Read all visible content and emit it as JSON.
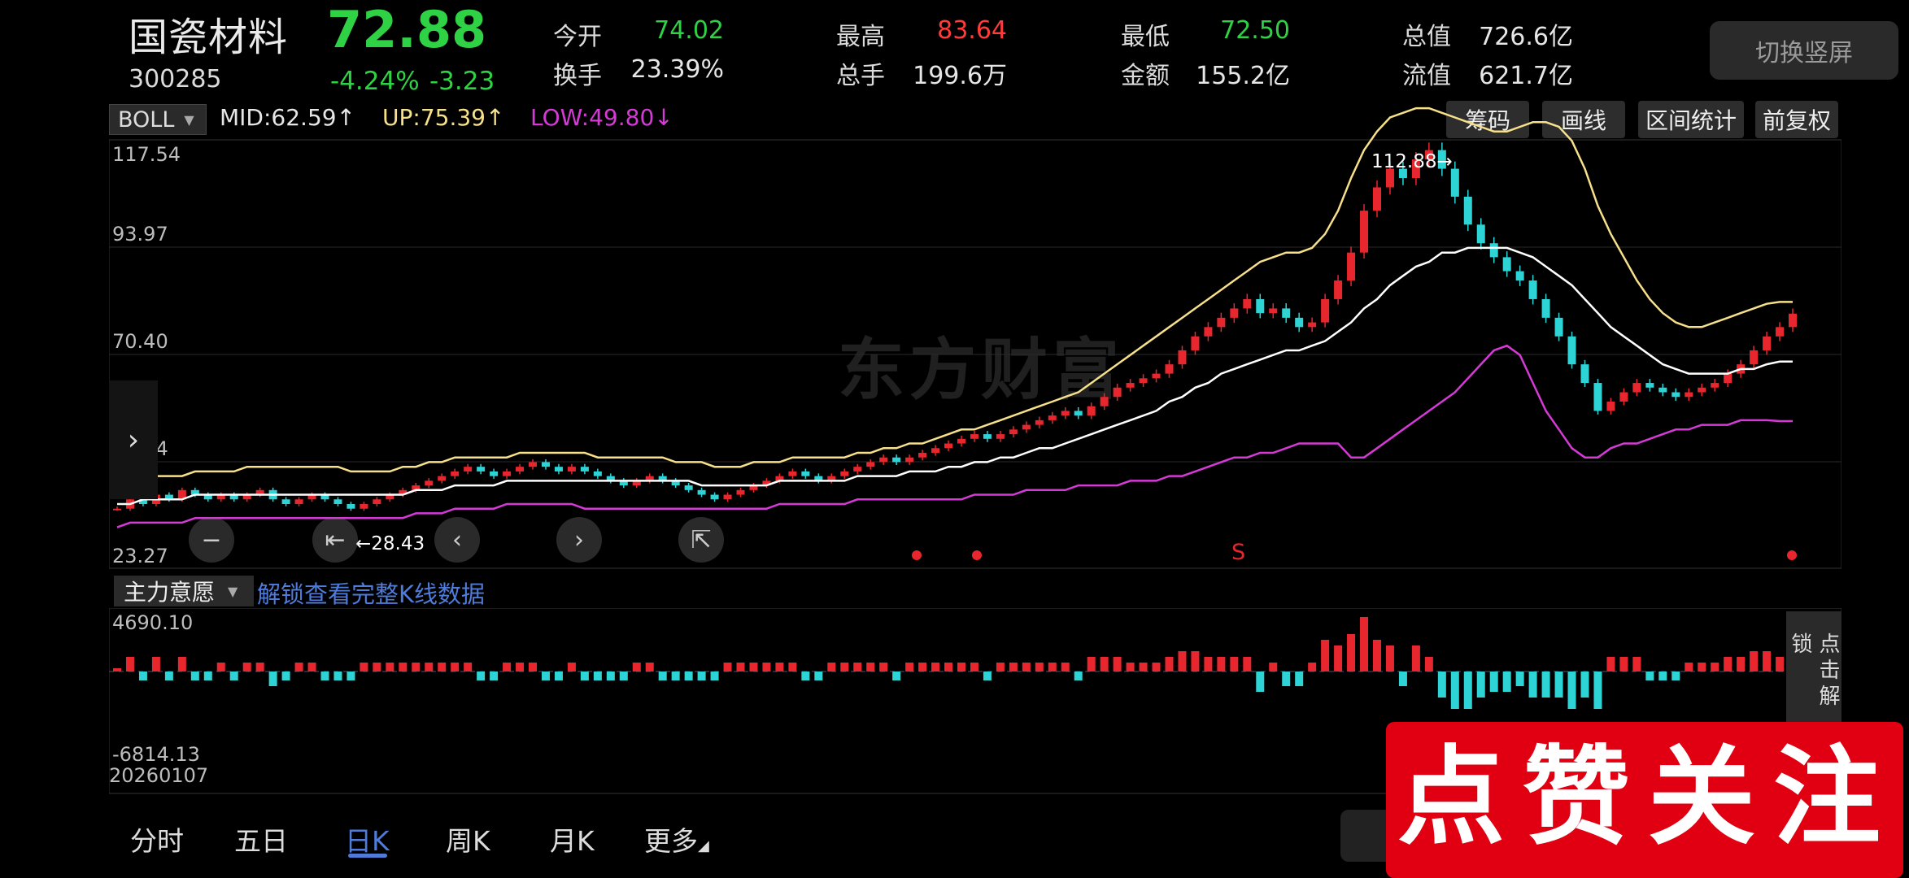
{
  "header": {
    "stock_name": "国瓷材料",
    "stock_code": "300285",
    "price": "72.88",
    "change_pct": "-4.24%",
    "change_amt": "-3.23",
    "stats": [
      {
        "label": "今开",
        "value": "74.02",
        "color": "green"
      },
      {
        "label": "换手",
        "value": "23.39%",
        "color": "white"
      },
      {
        "label": "最高",
        "value": "83.64",
        "color": "red"
      },
      {
        "label": "总手",
        "value": "199.6万",
        "color": "white"
      },
      {
        "label": "最低",
        "value": "72.50",
        "color": "green"
      },
      {
        "label": "金额",
        "value": "155.2亿",
        "color": "white"
      },
      {
        "label": "总值",
        "value": "726.6亿",
        "color": "white"
      },
      {
        "label": "流值",
        "value": "621.7亿",
        "color": "white"
      }
    ],
    "switch_label": "切换竖屏"
  },
  "indicator": {
    "name": "BOLL",
    "mid": "MID:62.59",
    "up": "UP:75.39",
    "low": "LOW:49.80",
    "mid_arrow": "↑",
    "up_arrow": "↑",
    "low_arrow": "↓"
  },
  "tools": [
    "筹码",
    "画线",
    "区间统计",
    "前复权"
  ],
  "watermark": "东方财富",
  "price_axis": [
    "117.54",
    "93.97",
    "70.40",
    "46.84",
    "23.27"
  ],
  "max_label": "112.88",
  "min_label": "28.43",
  "signal_s": "S",
  "sub_indicator": {
    "name": "主力意愿",
    "unlock_text": "解锁查看完整K线数据",
    "top_value": "4690.10",
    "bottom_value": "-6814.13",
    "side_button": "点击解锁"
  },
  "date_label": "20260107",
  "tabs": [
    "分时",
    "五日",
    "日K",
    "周K",
    "月K",
    "更多"
  ],
  "selected_tab": "日K",
  "promo_text": "点赞关注",
  "colors": {
    "up": "#e8262d",
    "down": "#2ed3d6",
    "upper_band": "#f6e08a",
    "mid_band": "#ffffff",
    "lower_band": "#d63ad6",
    "accent": "#4f7bd9"
  },
  "chart_data": {
    "type": "candlestick",
    "indicator": "BOLL",
    "ylim": [
      23.27,
      117.54
    ],
    "annotation_max": 112.88,
    "annotation_min": 28.43,
    "closes": [
      31,
      33,
      32,
      34,
      33,
      35,
      34,
      33,
      34,
      33,
      34,
      35,
      33,
      32,
      33,
      34,
      33,
      32,
      31,
      32,
      33,
      34,
      35,
      36,
      37,
      38,
      39,
      40,
      39,
      38,
      39,
      40,
      41,
      40,
      39,
      40,
      39,
      38,
      37,
      36,
      37,
      38,
      37,
      36,
      35,
      34,
      33,
      34,
      35,
      36,
      37,
      38,
      39,
      38,
      37,
      38,
      39,
      40,
      41,
      42,
      41,
      42,
      43,
      44,
      45,
      46,
      47,
      46,
      47,
      48,
      49,
      50,
      51,
      52,
      51,
      53,
      55,
      57,
      58,
      59,
      60,
      62,
      65,
      68,
      70,
      72,
      74,
      76,
      73,
      74,
      72,
      70,
      71,
      76,
      80,
      86,
      95,
      100,
      104,
      102,
      106,
      108,
      104,
      98,
      92,
      88,
      85,
      82,
      80,
      76,
      72,
      68,
      62,
      58,
      52,
      54,
      56,
      58,
      57,
      56,
      55,
      56,
      57,
      58,
      60,
      62,
      65,
      68,
      70,
      72.88
    ],
    "upper_band": [
      36,
      37,
      37,
      38,
      38,
      38,
      39,
      39,
      39,
      39,
      40,
      40,
      40,
      40,
      40,
      40,
      40,
      40,
      39,
      39,
      39,
      39,
      40,
      40,
      41,
      41,
      42,
      42,
      42,
      42,
      42,
      43,
      43,
      43,
      43,
      43,
      43,
      42,
      42,
      42,
      42,
      42,
      42,
      41,
      41,
      41,
      40,
      40,
      40,
      41,
      41,
      41,
      42,
      42,
      42,
      42,
      42,
      43,
      43,
      44,
      44,
      45,
      45,
      46,
      47,
      48,
      48,
      49,
      50,
      51,
      52,
      53,
      54,
      55,
      56,
      58,
      60,
      62,
      64,
      66,
      68,
      70,
      72,
      74,
      76,
      78,
      80,
      82,
      84,
      85,
      86,
      86,
      87,
      90,
      95,
      102,
      108,
      112,
      115,
      116,
      117,
      117,
      116,
      115,
      114,
      113,
      112,
      112,
      113,
      114,
      114,
      113,
      110,
      104,
      96,
      90,
      85,
      80,
      76,
      73,
      71,
      70,
      70,
      71,
      72,
      73,
      74,
      75,
      75.39,
      75.39
    ],
    "mid_band": [
      32,
      32,
      33,
      33,
      33,
      33,
      34,
      34,
      34,
      34,
      34,
      34,
      34,
      34,
      34,
      34,
      34,
      34,
      34,
      34,
      34,
      34,
      34,
      35,
      35,
      35,
      36,
      36,
      36,
      36,
      37,
      37,
      37,
      37,
      37,
      37,
      37,
      37,
      37,
      37,
      37,
      37,
      37,
      37,
      37,
      36,
      36,
      36,
      36,
      36,
      36,
      37,
      37,
      37,
      37,
      37,
      37,
      38,
      38,
      38,
      38,
      39,
      39,
      39,
      40,
      40,
      41,
      41,
      42,
      42,
      43,
      44,
      44,
      45,
      46,
      47,
      48,
      49,
      50,
      51,
      52,
      54,
      55,
      57,
      58,
      60,
      61,
      62,
      63,
      64,
      65,
      65,
      66,
      67,
      69,
      71,
      74,
      76,
      79,
      81,
      83,
      84,
      86,
      86,
      87,
      87,
      87,
      87,
      86,
      85,
      83,
      81,
      79,
      76,
      73,
      70,
      68,
      66,
      64,
      62,
      61,
      60,
      60,
      60,
      60,
      61,
      61,
      62,
      62.59,
      62.59
    ],
    "lower_band": [
      27,
      28,
      28,
      28,
      28,
      28,
      29,
      29,
      29,
      29,
      29,
      29,
      29,
      29,
      29,
      29,
      29,
      29,
      29,
      29,
      29,
      29,
      29,
      30,
      30,
      30,
      31,
      31,
      31,
      31,
      32,
      32,
      32,
      32,
      32,
      32,
      31,
      31,
      31,
      31,
      31,
      31,
      31,
      31,
      31,
      31,
      31,
      31,
      31,
      31,
      31,
      32,
      32,
      32,
      32,
      32,
      32,
      33,
      33,
      33,
      33,
      33,
      33,
      33,
      33,
      33,
      34,
      34,
      34,
      34,
      35,
      35,
      35,
      35,
      36,
      36,
      36,
      36,
      37,
      37,
      37,
      38,
      38,
      39,
      40,
      41,
      42,
      42,
      43,
      43,
      44,
      45,
      45,
      45,
      45,
      42,
      42,
      44,
      46,
      48,
      50,
      52,
      54,
      56,
      59,
      62,
      65,
      66,
      64,
      58,
      52,
      48,
      44,
      42,
      42,
      44,
      45,
      45,
      46,
      47,
      48,
      48,
      49,
      49,
      49,
      50,
      50,
      50,
      49.8,
      49.8
    ],
    "sub_indicator": {
      "name": "主力意愿",
      "ylim": [
        -6814.13,
        4690.1
      ]
    }
  }
}
